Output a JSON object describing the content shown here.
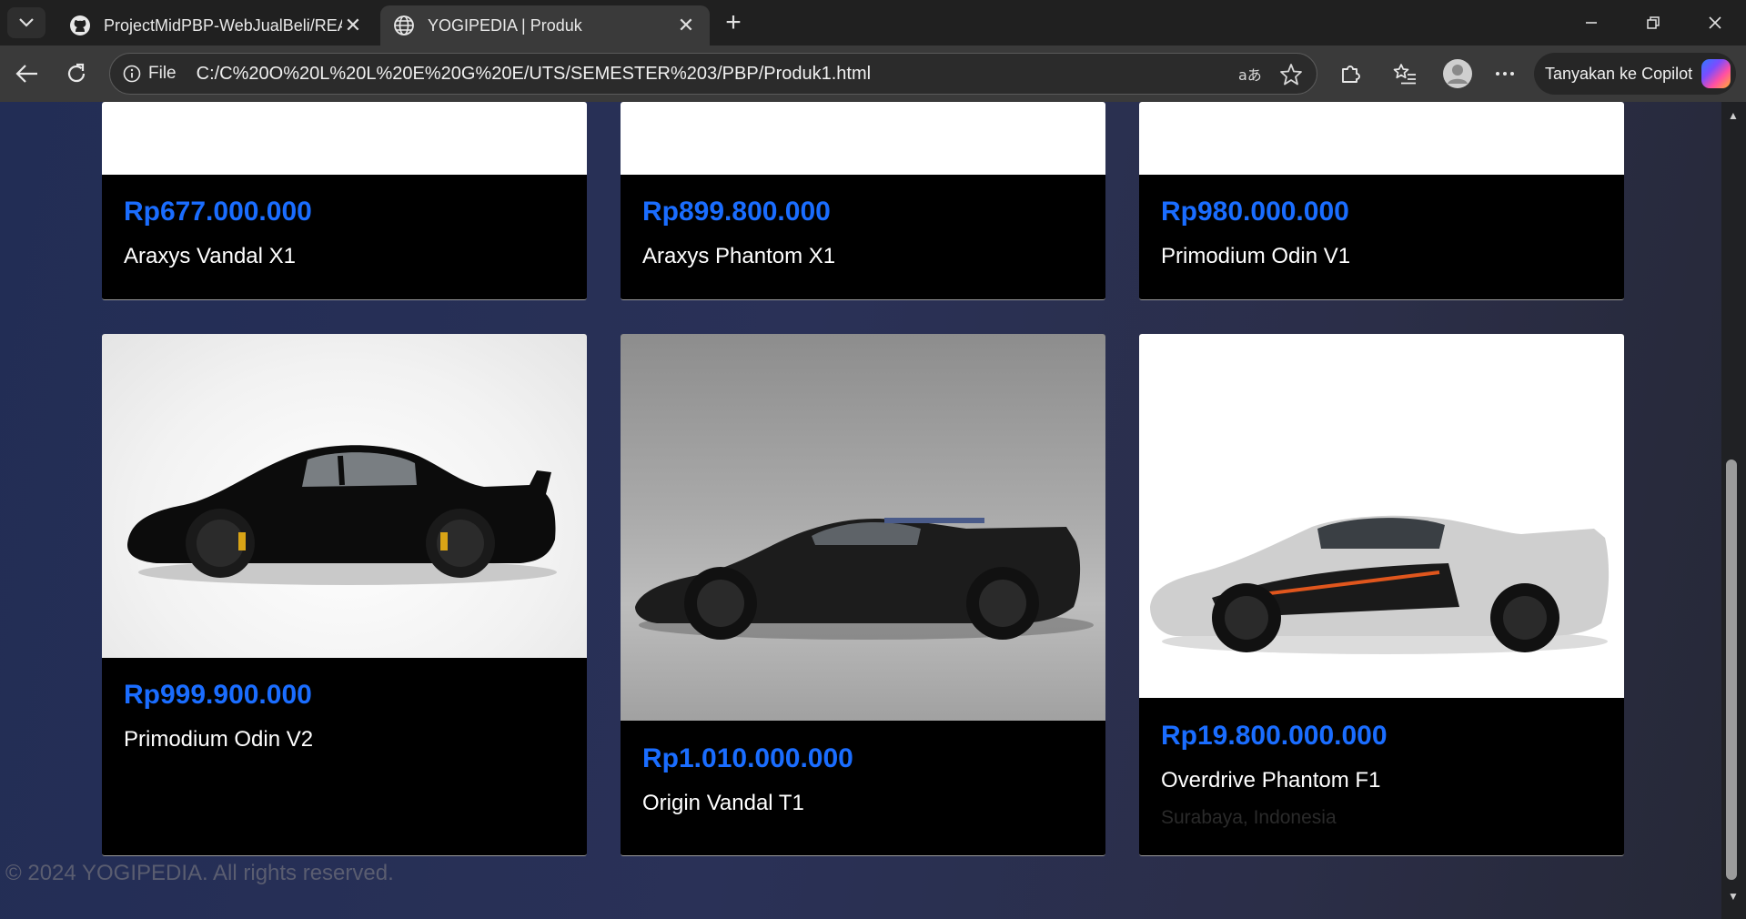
{
  "browser": {
    "tabs": [
      {
        "title": "ProjectMidPBP-WebJualBeli/READ",
        "icon": "github-icon",
        "active": false
      },
      {
        "title": "YOGIPEDIA | Produk",
        "icon": "globe-icon",
        "active": true
      }
    ],
    "address": {
      "scheme_label": "File",
      "url": "C:/C%20O%20L%20L%20E%20G%20E/UTS/SEMESTER%203/PBP/Produk1.html"
    },
    "copilot_label": "Tanyakan ke Copilot"
  },
  "products": [
    {
      "price": "Rp677.000.000",
      "name": "Araxys Vandal X1"
    },
    {
      "price": "Rp899.800.000",
      "name": "Araxys Phantom X1"
    },
    {
      "price": "Rp980.000.000",
      "name": "Primodium Odin V1"
    },
    {
      "price": "Rp999.900.000",
      "name": "Primodium Odin V2",
      "image": "black sports car"
    },
    {
      "price": "Rp1.010.000.000",
      "name": "Origin Vandal T1",
      "image": "dark carbon hypercar"
    },
    {
      "price": "Rp19.800.000.000",
      "name": "Overdrive Phantom F1",
      "location": "Surabaya, Indonesia",
      "image": "silver hypercar"
    }
  ],
  "footer": {
    "text": "© 2024 YOGIPEDIA. All rights reserved."
  },
  "colors": {
    "price": "#1a6dff",
    "card": "#000000",
    "background": "#252d52"
  }
}
